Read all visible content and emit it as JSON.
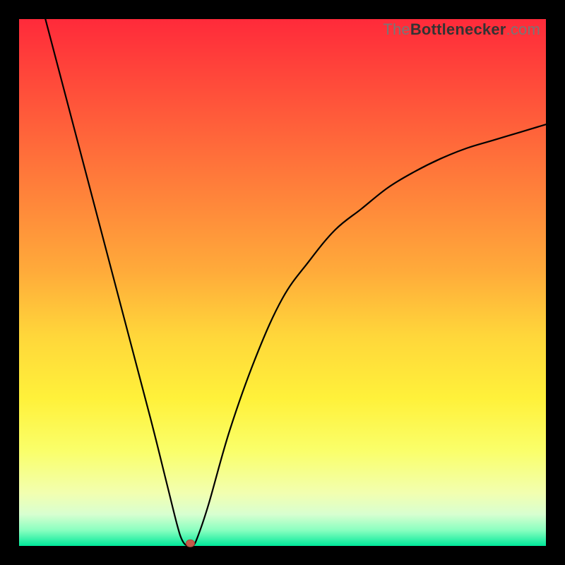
{
  "watermark": {
    "prefix": "The",
    "bold": "Bottlenecker",
    "suffix": ".com"
  },
  "chart_data": {
    "type": "line",
    "title": "",
    "xlabel": "",
    "ylabel": "",
    "xlim": [
      0,
      100
    ],
    "ylim": [
      0,
      100
    ],
    "grid": false,
    "series": [
      {
        "name": "bottleneck-curve",
        "x": [
          5,
          10,
          15,
          20,
          25,
          28,
          30,
          31,
          32,
          33,
          34,
          36,
          40,
          45,
          50,
          55,
          60,
          65,
          70,
          75,
          80,
          85,
          90,
          95,
          100
        ],
        "y": [
          100,
          81,
          62,
          43,
          24,
          12,
          4,
          1,
          0,
          0,
          2,
          8,
          22,
          36,
          47,
          54,
          60,
          64,
          68,
          71,
          73.5,
          75.5,
          77,
          78.5,
          80
        ]
      }
    ],
    "marker": {
      "name": "minimum-point",
      "x": 32.5,
      "y": 0.5,
      "color": "#c65a4a"
    },
    "background_gradient": {
      "top": "#ff2a3a",
      "middle": "#ffd63a",
      "bottom": "#00e89a"
    }
  }
}
